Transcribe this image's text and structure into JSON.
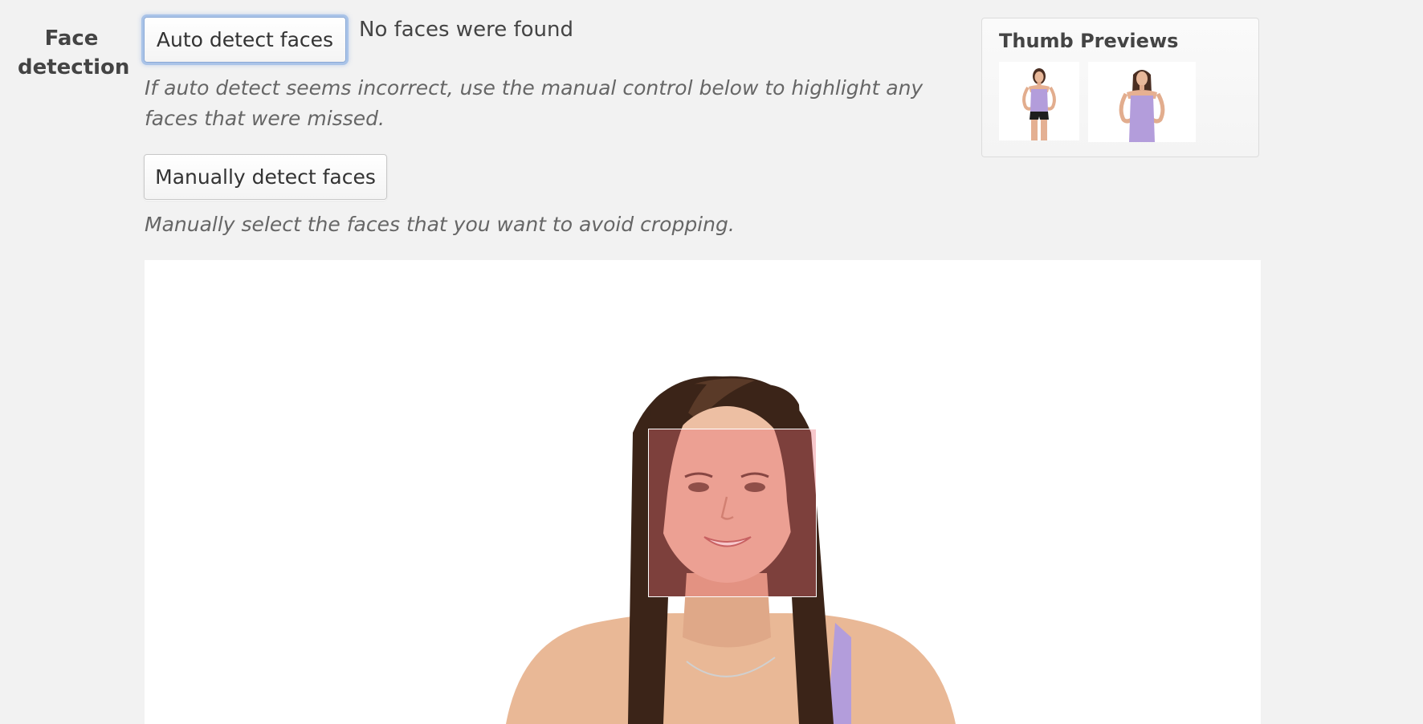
{
  "face_detection": {
    "label": "Face detection",
    "auto_button_label": "Auto detect faces",
    "status": "No faces were found",
    "auto_help": "If auto detect seems incorrect, use the manual control below to highlight any faces that were missed.",
    "manual_button_label": "Manually detect faces",
    "manual_help": "Manually select the faces that you want to avoid cropping."
  },
  "thumb_previews": {
    "title": "Thumb Previews",
    "items": [
      "thumbnail-1",
      "thumbnail-2"
    ]
  },
  "colors": {
    "background": "#f2f2f2",
    "focus_ring": "#a9c3e8",
    "face_highlight": "#eb6e78",
    "top_color": "#b39ddb"
  }
}
